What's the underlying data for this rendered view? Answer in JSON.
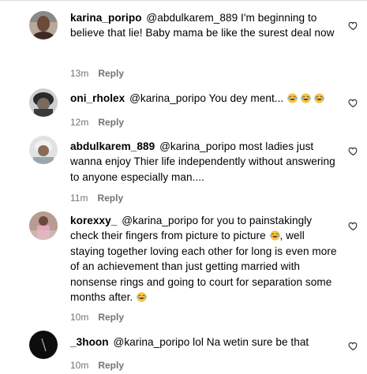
{
  "comments": [
    {
      "username": "karina_poripo",
      "mention": "@abdulkarem_889",
      "text": "I'm beginning to believe that lie! Baby mama be like the surest deal now",
      "emojis": [],
      "time": "13m",
      "reply_label": "Reply"
    },
    {
      "username": "oni_rholex",
      "mention": "@karina_poripo",
      "text": "You dey ment...",
      "emojis": [
        "laughing-tears",
        "laughing-tears",
        "laughing-tears"
      ],
      "time": "12m",
      "reply_label": "Reply"
    },
    {
      "username": "abdulkarem_889",
      "mention": "@karina_poripo",
      "text": "most ladies just wanna enjoy Thier life independently without answering to anyone especially man....",
      "emojis": [],
      "time": "11m",
      "reply_label": "Reply"
    },
    {
      "username": "korexxy_",
      "mention": "@karina_poripo",
      "text_before_emoji": "for you to painstakingly check their fingers from picture to picture",
      "text_after_emoji": ", well staying together loving each other for long is even more of an achievement than just getting married with nonsense rings and going to court for separation some months after.",
      "emojis": [
        "laughing-tears",
        "laughing-tears"
      ],
      "time": "10m",
      "reply_label": "Reply"
    },
    {
      "username": "_3hoon",
      "mention": "@karina_poripo",
      "text": "lol Na wetin sure be that",
      "emojis": [],
      "time": "10m",
      "reply_label": "Reply"
    }
  ],
  "colors": {
    "text": "#000000",
    "meta": "#737373",
    "heart_outline": "#262626",
    "emoji": "#f4c542"
  },
  "icons": {
    "like": "heart-outline-icon",
    "emoji": "face-with-tears-of-joy-icon"
  }
}
